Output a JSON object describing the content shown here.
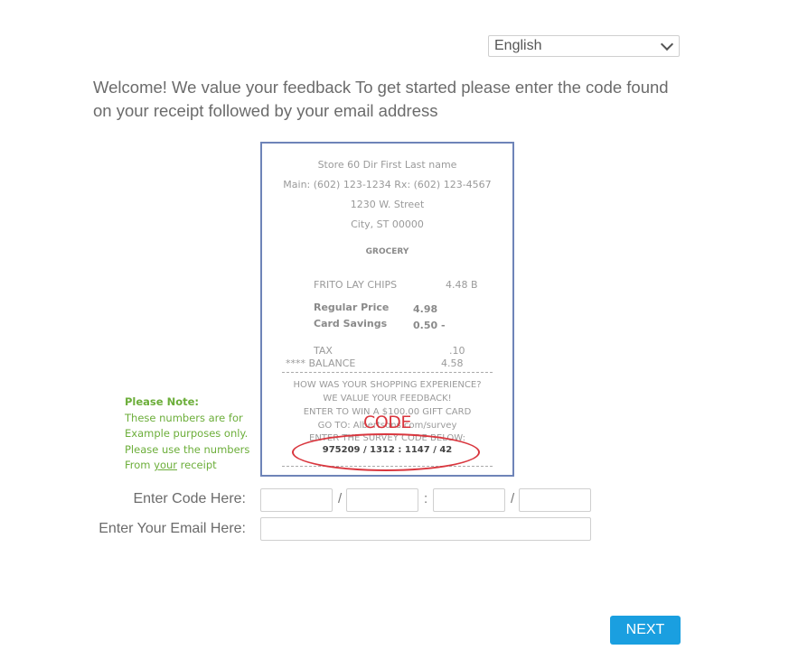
{
  "language_select": {
    "value": "English",
    "icon": "chevron-down-icon"
  },
  "welcome_text": "Welcome! We value your feedback To get started please enter the code found on your receipt followed by your email address",
  "receipt": {
    "header_lines": [
      "Store 60 Dir First Last name",
      "Main: (602) 123-1234 Rx: (602) 123-4567",
      "1230 W. Street",
      "City, ST 00000"
    ],
    "department": "GROCERY",
    "item_name": "FRITO LAY CHIPS",
    "item_price": "4.48 B",
    "regular_price_label": "Regular  Price",
    "regular_price_value": "4.98",
    "card_savings_label": "Card Savings",
    "card_savings_value": "0.50 -",
    "tax_label": "TAX",
    "tax_value": ".10",
    "balance_label": "**** BALANCE",
    "balance_value": "4.58",
    "survey_lines": [
      "HOW WAS YOUR SHOPPING EXPERIENCE?",
      "WE VALUE YOUR FEEDBACK!",
      "ENTER TO WIN A $100.00 GIFT CARD",
      "GO TO: Albertsons.com/survey",
      "ENTER THE SURVEY CODE BELOW:"
    ],
    "survey_code": "975209 / 1312 : 1147 / 42",
    "code_annotation": "CODE"
  },
  "note": {
    "heading": "Please Note:",
    "line1": "These numbers are for",
    "line2": "Example purposes only.",
    "line3": "Please use the numbers",
    "line4_prefix": "From ",
    "line4_underlined": "your",
    "line4_suffix": " receipt"
  },
  "form": {
    "code_label": "Enter Code Here:",
    "code_fields": [
      "",
      "",
      "",
      ""
    ],
    "separators": [
      "/",
      ":",
      "/"
    ],
    "email_label": "Enter Your Email Here:",
    "email_value": ""
  },
  "next_button": "NEXT",
  "colors": {
    "accent": "#1a9fe0",
    "note_green": "#6cae3a",
    "annotation_red": "#d9363e",
    "receipt_border": "#6e84b8"
  }
}
